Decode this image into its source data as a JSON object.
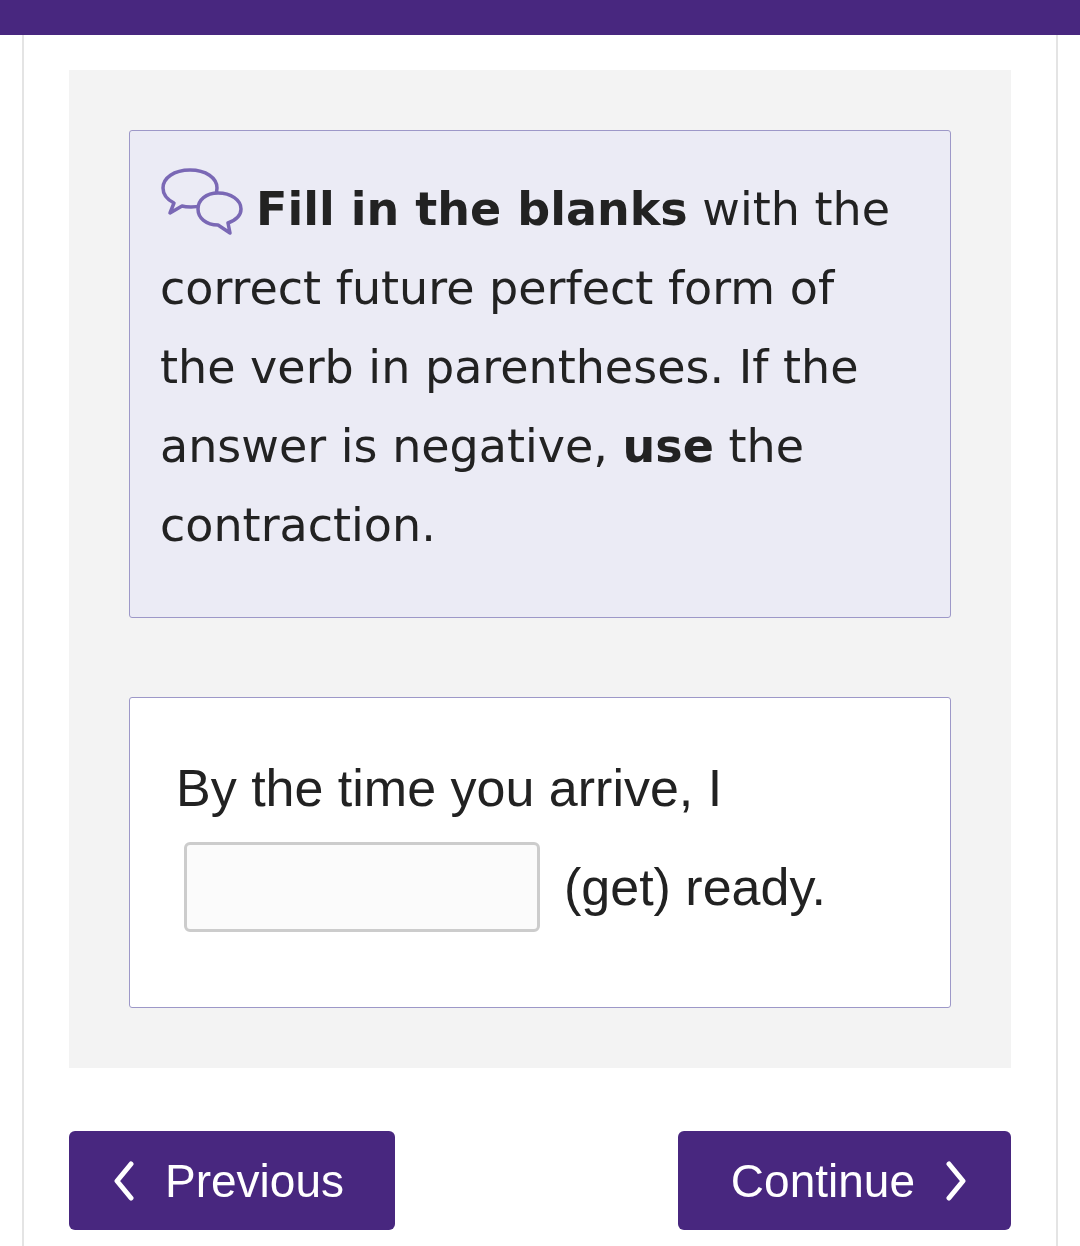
{
  "instruction": {
    "first_line": "**Fill in the blanks** with the",
    "rest": "correct future perfect form of the verb in parentheses. If the answer is negative, **use** the contraction."
  },
  "question": {
    "before": "By the time you arrive, I",
    "after": "(get) ready."
  },
  "buttons": [
    {
      "kind": "previous",
      "label": "Previous"
    },
    {
      "kind": "next",
      "label": "Continue"
    }
  ]
}
